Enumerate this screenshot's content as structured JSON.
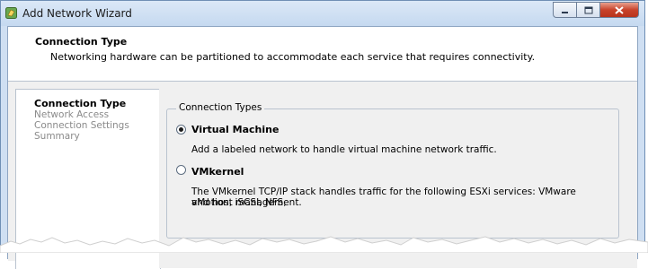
{
  "window": {
    "title": "Add Network Wizard",
    "controls": {
      "minimize": "minimize-icon",
      "maximize": "maximize-icon",
      "close": "close-icon"
    }
  },
  "header": {
    "title": "Connection Type",
    "description": "Networking hardware can be partitioned to accommodate each service that requires connectivity."
  },
  "steps": [
    {
      "label": "Connection Type",
      "active": true
    },
    {
      "label": "Network Access",
      "active": false
    },
    {
      "label": "Connection Settings",
      "active": false
    },
    {
      "label": "Summary",
      "active": false
    }
  ],
  "connection_types": {
    "legend": "Connection Types",
    "options": [
      {
        "label": "Virtual Machine",
        "selected": true,
        "description": "Add a labeled network to handle virtual machine network traffic."
      },
      {
        "label": "VMkernel",
        "selected": false,
        "description_line1": "The VMkernel TCP/IP stack handles traffic for the following ESXi services: VMware vMotion, iSCSI, NFS,",
        "description_line2": "and host management."
      }
    ]
  },
  "colors": {
    "titlebar": "#c5d9f0",
    "close_button": "#c8432b",
    "panel_background": "#f0f0f0",
    "inactive_step_text": "#8a8a8a"
  }
}
